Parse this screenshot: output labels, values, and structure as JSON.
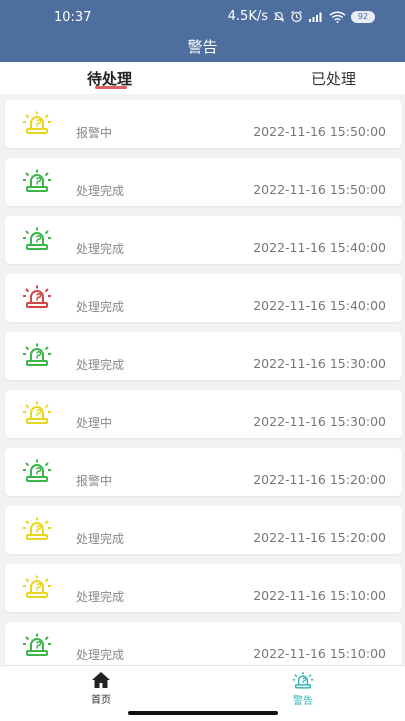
{
  "status_bar": {
    "time": "10:37",
    "speed": "4.5K/s",
    "battery": "92"
  },
  "header": {
    "title": "警告"
  },
  "tabs": [
    {
      "label": "待处理"
    },
    {
      "label": "已处理"
    }
  ],
  "colors": {
    "header": "#4d6e9f",
    "yellow": "#e8d71c",
    "green": "#3cb54a",
    "red": "#d44545",
    "accent": "#2db3b3",
    "underline": "#e06060"
  },
  "alerts": [
    {
      "status": "报警中",
      "time": "2022-11-16 15:50:00",
      "color": "yellow"
    },
    {
      "status": "处理完成",
      "time": "2022-11-16 15:50:00",
      "color": "green"
    },
    {
      "status": "处理完成",
      "time": "2022-11-16 15:40:00",
      "color": "green"
    },
    {
      "status": "处理完成",
      "time": "2022-11-16 15:40:00",
      "color": "red"
    },
    {
      "status": "处理完成",
      "time": "2022-11-16 15:30:00",
      "color": "green"
    },
    {
      "status": "处理中",
      "time": "2022-11-16 15:30:00",
      "color": "yellow"
    },
    {
      "status": "报警中",
      "time": "2022-11-16 15:20:00",
      "color": "green"
    },
    {
      "status": "处理完成",
      "time": "2022-11-16 15:20:00",
      "color": "yellow"
    },
    {
      "status": "处理完成",
      "time": "2022-11-16 15:10:00",
      "color": "yellow"
    },
    {
      "status": "处理完成",
      "time": "2022-11-16 15:10:00",
      "color": "green"
    }
  ],
  "bottom_nav": [
    {
      "label": "首页",
      "icon": "home-icon"
    },
    {
      "label": "警告",
      "icon": "alarm-icon"
    }
  ]
}
